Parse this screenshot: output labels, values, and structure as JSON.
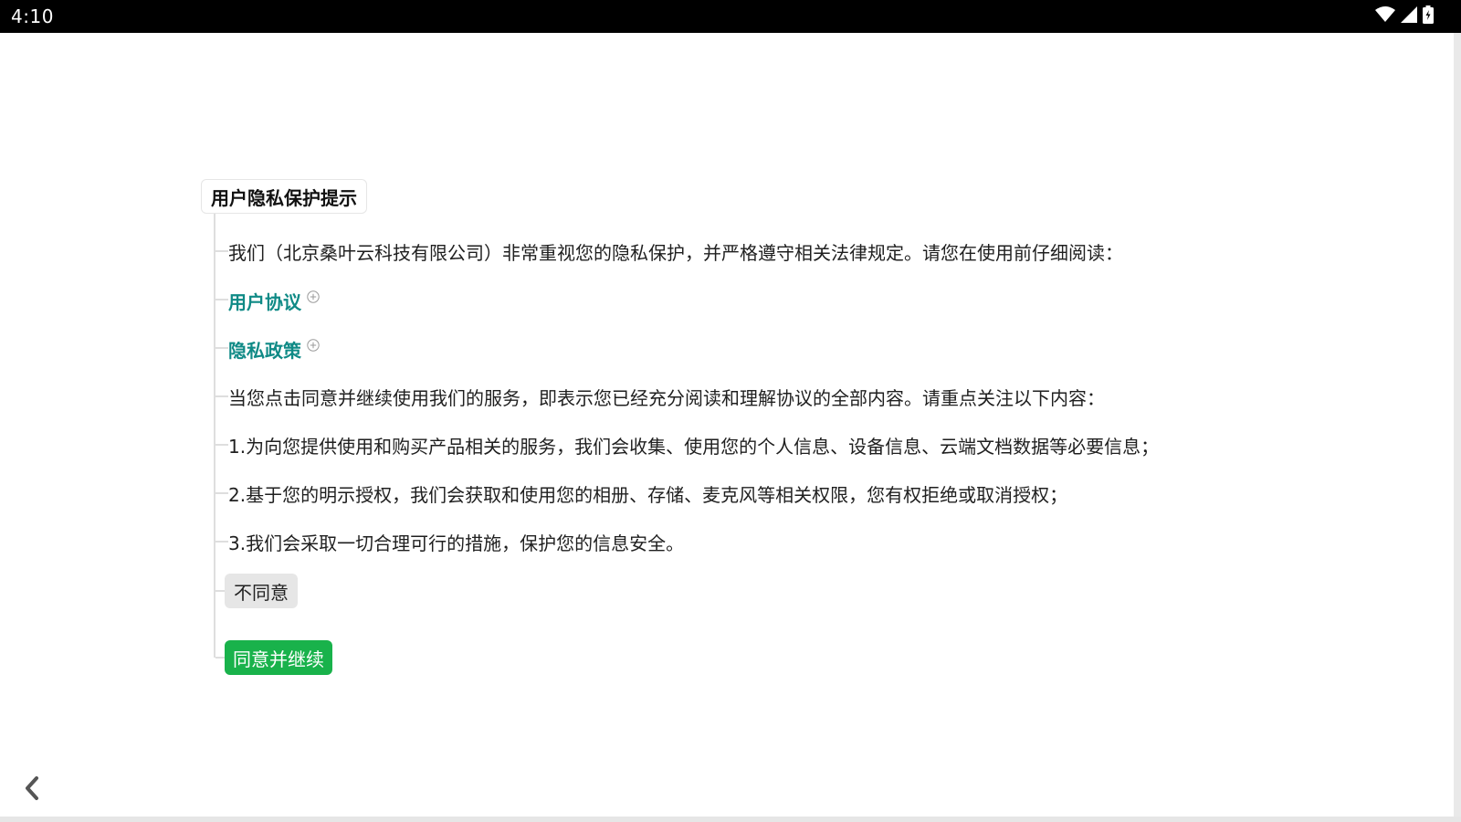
{
  "status_bar": {
    "time": "4:10",
    "icons": [
      "wifi-icon",
      "signal-icon",
      "battery-icon"
    ]
  },
  "dialog": {
    "title": "用户隐私保护提示",
    "intro": "我们（北京桑叶云科技有限公司）非常重视您的隐私保护，并严格遵守相关法律规定。请您在使用前仔细阅读：",
    "links": [
      {
        "label": "用户协议",
        "icon": "expand-plus-icon"
      },
      {
        "label": "隐私政策",
        "icon": "expand-plus-icon"
      }
    ],
    "notice": "当您点击同意并继续使用我们的服务，即表示您已经充分阅读和理解协议的全部内容。请重点关注以下内容：",
    "points": [
      "1.为向您提供使用和购买产品相关的服务，我们会收集、使用您的个人信息、设备信息、云端文档数据等必要信息；",
      "2.基于您的明示授权，我们会获取和使用您的相册、存储、麦克风等相关权限，您有权拒绝或取消授权；",
      "3.我们会采取一切合理可行的措施，保护您的信息安全。"
    ],
    "disagree_label": "不同意",
    "agree_label": "同意并继续"
  },
  "navigation": {
    "back_icon": "chevron-left-icon"
  },
  "colors": {
    "link": "#0f8a86",
    "agree_button": "#19b24b",
    "disagree_button": "#e6e6e6",
    "status_bar": "#000000"
  }
}
